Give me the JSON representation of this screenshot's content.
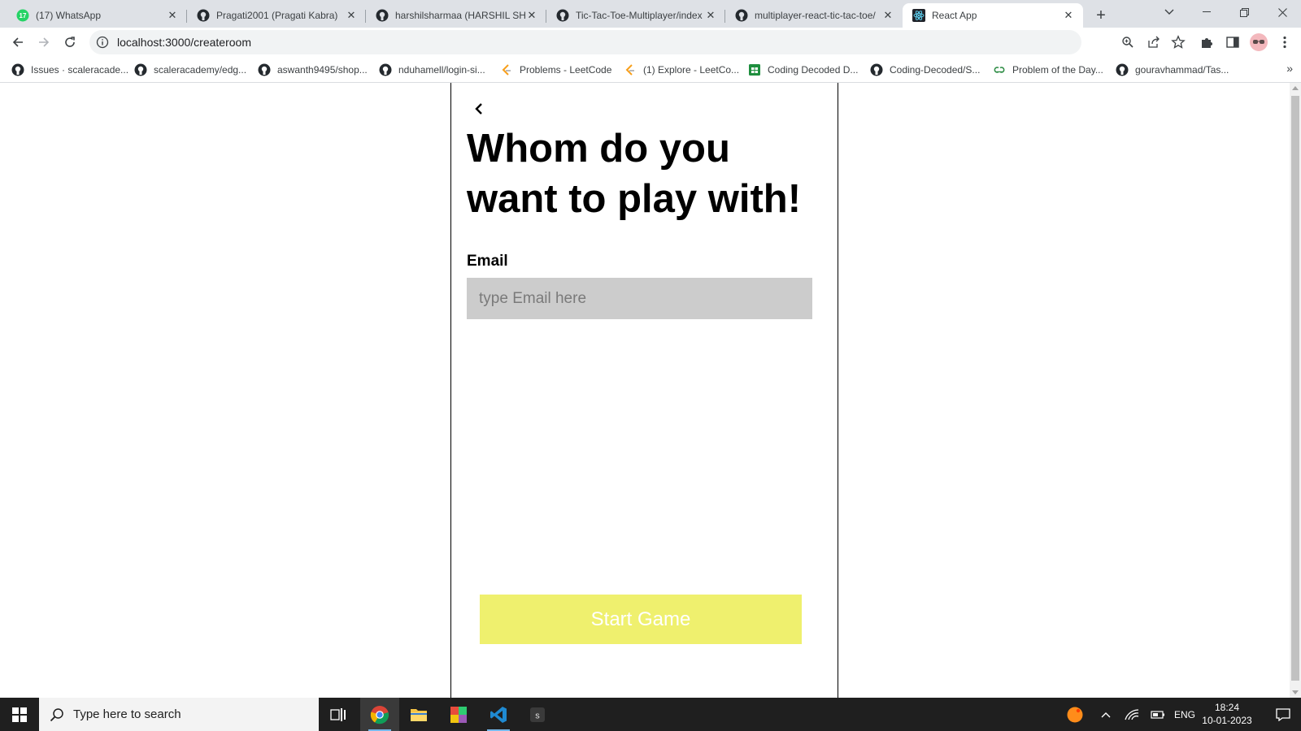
{
  "tabs": [
    {
      "title": "(17) WhatsApp",
      "icon": "whatsapp-icon",
      "badge": "17",
      "active": false
    },
    {
      "title": "Pragati2001 (Pragati Kabra)",
      "icon": "github-icon",
      "active": false
    },
    {
      "title": "harshilsharmaa (HARSHIL SHARMA)",
      "icon": "github-icon",
      "active": false
    },
    {
      "title": "Tic-Tac-Toe-Multiplayer/index",
      "icon": "github-icon",
      "active": false
    },
    {
      "title": "multiplayer-react-tic-tac-toe/",
      "icon": "github-icon",
      "active": false
    },
    {
      "title": "React App",
      "icon": "react-icon",
      "active": true
    }
  ],
  "address": {
    "url": "localhost:3000/createroom"
  },
  "bookmarks": [
    {
      "label": "Issues · scaleracade...",
      "icon": "github-icon"
    },
    {
      "label": "scaleracademy/edg...",
      "icon": "github-icon"
    },
    {
      "label": "aswanth9495/shop...",
      "icon": "github-icon"
    },
    {
      "label": "nduhamell/login-si...",
      "icon": "github-icon"
    },
    {
      "label": "Problems - LeetCode",
      "icon": "leetcode-icon"
    },
    {
      "label": "(1) Explore - LeetCo...",
      "icon": "leetcode-icon"
    },
    {
      "label": "Coding Decoded D...",
      "icon": "sheets-icon"
    },
    {
      "label": "Coding-Decoded/S...",
      "icon": "github-icon"
    },
    {
      "label": "Problem of the Day...",
      "icon": "gfg-icon"
    },
    {
      "label": "gouravhammad/Tas...",
      "icon": "github-icon"
    }
  ],
  "page": {
    "heading": "Whom do you want to play with!",
    "email_label": "Email",
    "email_placeholder": "type Email here",
    "email_value": "",
    "start_button": "Start Game",
    "accent_color": "#eff06e"
  },
  "taskbar": {
    "search_placeholder": "Type here to search",
    "language": "ENG",
    "time": "18:24",
    "date": "10-01-2023"
  }
}
